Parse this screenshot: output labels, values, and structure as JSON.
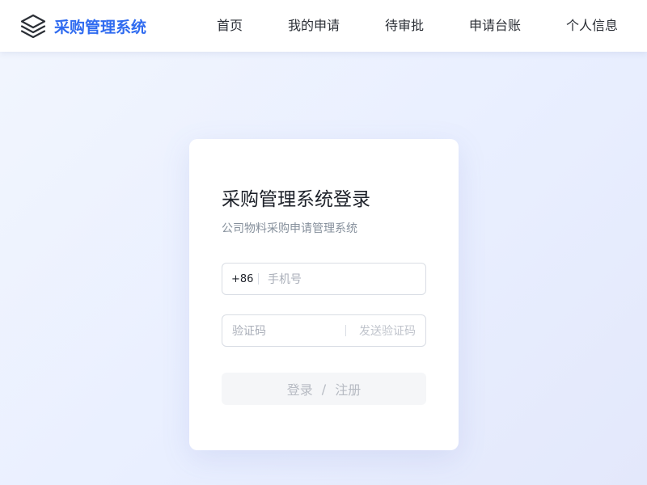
{
  "header": {
    "brand_name": "采购管理系统",
    "logo_icon": "layers-icon",
    "accent_color": "#2f6bf0"
  },
  "nav": {
    "items": [
      {
        "label": "首页"
      },
      {
        "label": "我的申请"
      },
      {
        "label": "待审批"
      },
      {
        "label": "申请台账"
      },
      {
        "label": "个人信息"
      }
    ]
  },
  "login": {
    "title": "采购管理系统登录",
    "subtitle": "公司物料采购申请管理系统",
    "phone": {
      "prefix": "+86",
      "placeholder": "手机号",
      "value": ""
    },
    "code": {
      "placeholder": "验证码",
      "value": "",
      "send_label": "发送验证码"
    },
    "submit": {
      "login_label": "登录",
      "separator": "/",
      "register_label": "注册"
    }
  }
}
